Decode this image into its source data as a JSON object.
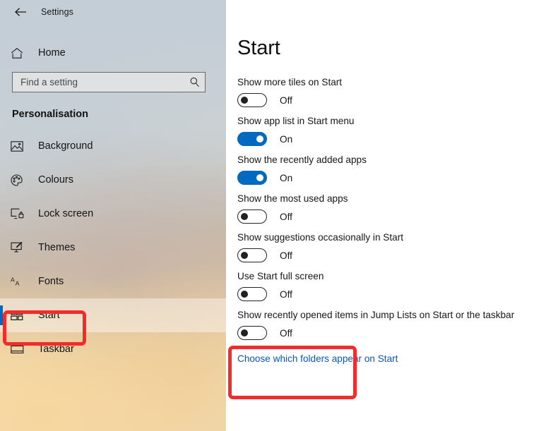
{
  "window": {
    "title": "Settings",
    "back_icon": "back-arrow-icon"
  },
  "sidebar": {
    "home": {
      "label": "Home",
      "icon": "home-icon"
    },
    "search": {
      "placeholder": "Find a setting",
      "value": "",
      "icon": "search-icon"
    },
    "section_heading": "Personalisation",
    "items": [
      {
        "label": "Background",
        "icon": "picture-icon",
        "selected": false
      },
      {
        "label": "Colours",
        "icon": "palette-icon",
        "selected": false
      },
      {
        "label": "Lock screen",
        "icon": "lock-screen-icon",
        "selected": false
      },
      {
        "label": "Themes",
        "icon": "themes-brush-icon",
        "selected": false
      },
      {
        "label": "Fonts",
        "icon": "fonts-aa-icon",
        "selected": false
      },
      {
        "label": "Start",
        "icon": "start-tiles-icon",
        "selected": true
      },
      {
        "label": "Taskbar",
        "icon": "taskbar-icon",
        "selected": false
      }
    ]
  },
  "main": {
    "title": "Start",
    "settings": [
      {
        "label": "Show more tiles on Start",
        "state": "Off",
        "on": false
      },
      {
        "label": "Show app list in Start menu",
        "state": "On",
        "on": true
      },
      {
        "label": "Show the recently added apps",
        "state": "On",
        "on": true
      },
      {
        "label": "Show the most used apps",
        "state": "Off",
        "on": false
      },
      {
        "label": "Show suggestions occasionally in Start",
        "state": "Off",
        "on": false
      },
      {
        "label": "Use Start full screen",
        "state": "Off",
        "on": false
      },
      {
        "label": "Show recently opened items in Jump Lists on Start or the taskbar",
        "state": "Off",
        "on": false
      }
    ],
    "folders_link": "Choose which folders appear on Start"
  },
  "annotations": {
    "accent_color": "#f42b2b",
    "boxes": [
      {
        "name": "sidebar-start-highlight",
        "target": "Start"
      },
      {
        "name": "jump-lists-highlight",
        "target": "Show recently opened items in Jump Lists on Start or the taskbar"
      }
    ]
  },
  "colors": {
    "toggle_on": "#0069c0",
    "selection_bar": "#0067c0",
    "link": "#0b58b5",
    "annotation_red": "#f42b2b"
  }
}
